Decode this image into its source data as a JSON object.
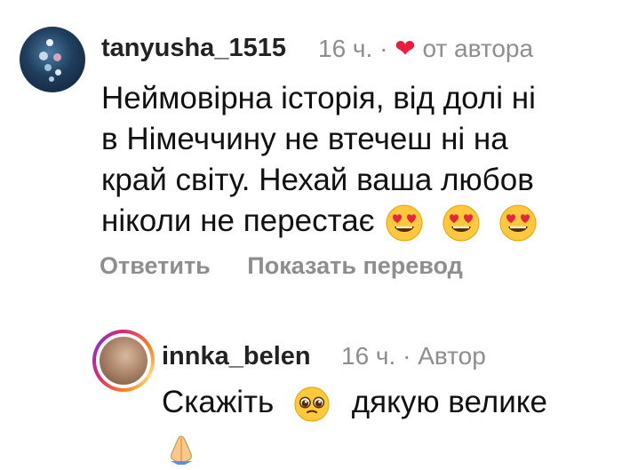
{
  "comment1": {
    "username": "tanyusha_1515",
    "time": "16 ч.",
    "separator": "·",
    "liked_by_author_label": "от автора",
    "text_lines": [
      "Неймовірна історія, від долі  ні",
      "в Німеччину не втечеш ні на",
      "край світу. Нехай ваша любов",
      "ніколи не перестає"
    ],
    "emojis": [
      "smiling-face-with-heart-eyes",
      "smiling-face-with-heart-eyes",
      "smiling-face-with-heart-eyes"
    ],
    "reply_label": "Ответить",
    "translate_label": "Показать перевод"
  },
  "comment2": {
    "username": "innka_belen",
    "time": "16 ч.",
    "separator": "·",
    "author_badge": "Автор",
    "text_before_emoji": "Скажіть",
    "text_after_emoji": "дякую велике",
    "emojis": [
      "pleading-face",
      "folded-hands"
    ]
  },
  "colors": {
    "secondary_text": "#8e8e8e",
    "heart": "#ed1c3a"
  }
}
